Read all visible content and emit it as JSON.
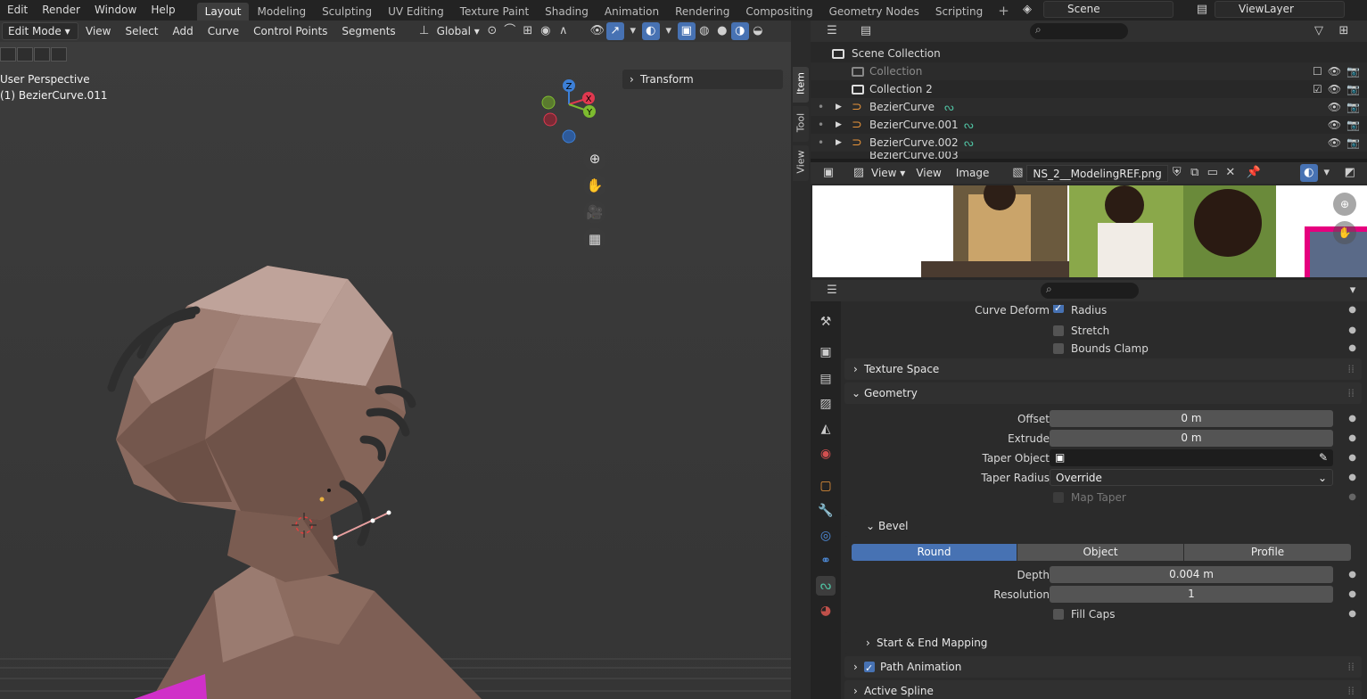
{
  "menu": {
    "items": [
      "Edit",
      "Render",
      "Window",
      "Help"
    ]
  },
  "workspaces": [
    {
      "label": "Layout",
      "active": true
    },
    {
      "label": "Modeling"
    },
    {
      "label": "Sculpting"
    },
    {
      "label": "UV Editing"
    },
    {
      "label": "Texture Paint"
    },
    {
      "label": "Shading"
    },
    {
      "label": "Animation"
    },
    {
      "label": "Rendering"
    },
    {
      "label": "Compositing"
    },
    {
      "label": "Geometry Nodes"
    },
    {
      "label": "Scripting"
    }
  ],
  "scene": {
    "name": "Scene",
    "view_layer": "ViewLayer"
  },
  "viewport": {
    "mode": "Edit Mode",
    "menus": [
      "View",
      "Select",
      "Add",
      "Curve",
      "Control Points",
      "Segments"
    ],
    "orientation": "Global",
    "perspective": "User Perspective",
    "object": "(1) BezierCurve.011",
    "transform_panel": "Transform",
    "side_tabs": [
      "Item",
      "Tool",
      "View"
    ],
    "gizmo": {
      "z": "Z",
      "x": "X",
      "y": "Y"
    }
  },
  "outliner": {
    "root": "Scene Collection",
    "rows": [
      {
        "label": "Collection",
        "dim": true
      },
      {
        "label": "Collection 2"
      },
      {
        "label": "BezierCurve"
      },
      {
        "label": "BezierCurve.001"
      },
      {
        "label": "BezierCurve.002"
      },
      {
        "label": "BezierCurve.003"
      }
    ]
  },
  "image_editor": {
    "view_label": "View",
    "menus": [
      "View",
      "Image"
    ],
    "image_name": "NS_2__ModelingREF.png"
  },
  "properties": {
    "curve_deform_label": "Curve Deform",
    "radius": "Radius",
    "stretch": "Stretch",
    "bounds_clamp": "Bounds Clamp",
    "texture_space": "Texture Space",
    "geometry": "Geometry",
    "offset_label": "Offset",
    "offset_value": "0 m",
    "extrude_label": "Extrude",
    "extrude_value": "0 m",
    "taper_object_label": "Taper Object",
    "taper_radius_label": "Taper Radius",
    "taper_radius_value": "Override",
    "map_taper": "Map Taper",
    "bevel": "Bevel",
    "bevel_modes": [
      "Round",
      "Object",
      "Profile"
    ],
    "depth_label": "Depth",
    "depth_value": "0.004 m",
    "resolution_label": "Resolution",
    "resolution_value": "1",
    "fill_caps": "Fill Caps",
    "start_end_mapping": "Start & End Mapping",
    "path_animation": "Path Animation",
    "active_spline": "Active Spline"
  },
  "colors": {
    "accent": "#4772b3",
    "curve_orange": "#e8943a",
    "x_axis": "#e0384f",
    "y_axis": "#7dbb2f",
    "z_axis": "#3c7fd6"
  }
}
